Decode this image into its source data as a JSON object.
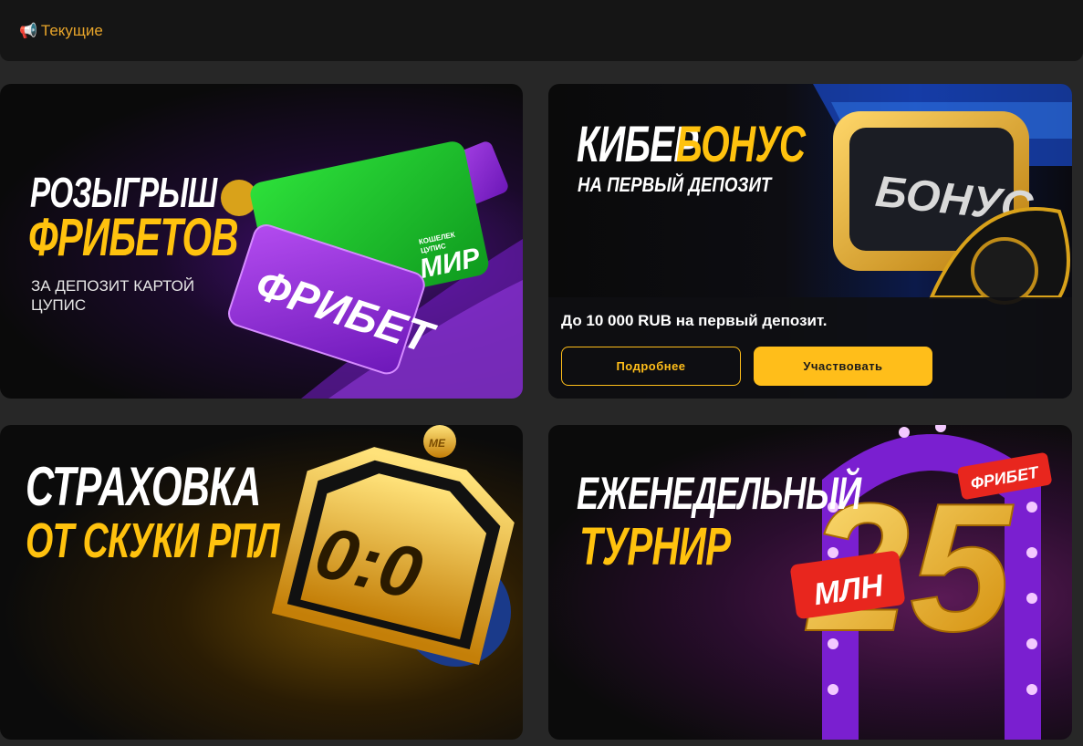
{
  "header": {
    "icon": "megaphone-icon",
    "title": "Текущие"
  },
  "promos": {
    "freebet": {
      "title_line1": "РОЗЫГРЫШ",
      "title_line2": "ФРИБЕТОВ",
      "subtitle_line1": "ЗА ДЕПОЗИТ КАРТОЙ",
      "subtitle_line2": "ЦУПИС",
      "art_ticket": "ФРИБЕТ",
      "art_card_brand": "МИР",
      "art_card_wallet_line1": "КОШЕЛЕК",
      "art_card_wallet_line2": "ЦУПИС"
    },
    "cyber": {
      "title_white": "КИБЕР",
      "title_yellow": "БОНУС",
      "subtitle": "НА ПЕРВЫЙ ДЕПОЗИТ",
      "art_screen": "БОНУС",
      "description": "До 10 000 RUB на первый депозит.",
      "more_label": "Подробнее",
      "join_label": "Участвовать"
    },
    "insurance": {
      "title_line1": "СТРАХОВКА",
      "title_line2": "ОТ СКУКИ РПЛ",
      "art_score": "0:0",
      "art_coin": "МЕ"
    },
    "tournament": {
      "title_line1": "ЕЖЕНЕДЕЛЬНЫЙ",
      "title_line2": "ТУРНИР",
      "art_number": "25",
      "art_unit": "МЛН",
      "art_ticket": "ФРИБЕТ"
    }
  },
  "colors": {
    "accent": "#ffbe1a",
    "header_text": "#e8a52a",
    "page_bg": "#272727",
    "header_bg": "#151515"
  }
}
